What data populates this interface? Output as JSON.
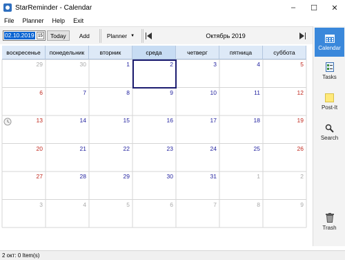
{
  "window": {
    "title": "StarReminder - Calendar",
    "controls": [
      "–",
      "☐",
      "✕"
    ]
  },
  "menu": [
    "File",
    "Planner",
    "Help",
    "Exit"
  ],
  "toolbar": {
    "date_value": "02.10.2019",
    "today_label": "Today",
    "add_label": "Add",
    "planner_label": "Planner",
    "month_title": "Октябрь 2019"
  },
  "weekdays": [
    "воскресенье",
    "понедельник",
    "вторник",
    "среда",
    "четверг",
    "пятница",
    "суббота"
  ],
  "weeks": [
    [
      "29",
      "30",
      "1",
      "2",
      "3",
      "4",
      "5"
    ],
    [
      "6",
      "7",
      "8",
      "9",
      "10",
      "11",
      "12"
    ],
    [
      "13",
      "14",
      "15",
      "16",
      "17",
      "18",
      "19"
    ],
    [
      "20",
      "21",
      "22",
      "23",
      "24",
      "25",
      "26"
    ],
    [
      "27",
      "28",
      "29",
      "30",
      "31",
      "1",
      "2"
    ],
    [
      "3",
      "4",
      "5",
      "6",
      "7",
      "8",
      "9"
    ]
  ],
  "selected_day": "2",
  "sidebar": [
    {
      "label": "Calendar",
      "icon": "calendar-icon",
      "active": true
    },
    {
      "label": "Tasks",
      "icon": "tasks-icon",
      "active": false
    },
    {
      "label": "Post-It",
      "icon": "post-it-icon",
      "active": false
    },
    {
      "label": "Search",
      "icon": "search-icon",
      "active": false
    },
    {
      "label": "Trash",
      "icon": "trash-icon",
      "active": false
    }
  ],
  "status": "2 окт: 0 Item(s)",
  "colors": {
    "accent": "#3a88db",
    "weekend": "#c0281e",
    "current_month": "#1f1f9e",
    "other_month": "#a9a9a9",
    "header_bg": "#dde9f7"
  }
}
